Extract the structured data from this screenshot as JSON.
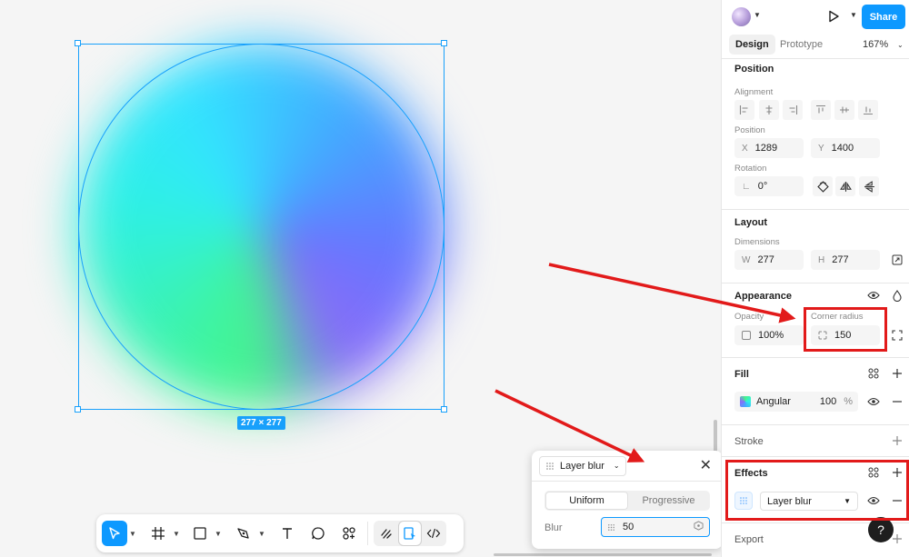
{
  "canvas": {
    "selection_size": "277 × 277"
  },
  "header": {
    "share_label": "Share",
    "tab_design": "Design",
    "tab_prototype": "Prototype",
    "zoom": "167%"
  },
  "position": {
    "title": "Position",
    "alignment_label": "Alignment",
    "position_label": "Position",
    "x_prefix": "X",
    "x_value": "1289",
    "y_prefix": "Y",
    "y_value": "1400",
    "rotation_label": "Rotation",
    "rotation_value": "0°"
  },
  "layout": {
    "title": "Layout",
    "dimensions_label": "Dimensions",
    "w_prefix": "W",
    "w_value": "277",
    "h_prefix": "H",
    "h_value": "277"
  },
  "appearance": {
    "title": "Appearance",
    "opacity_label": "Opacity",
    "opacity_value": "100%",
    "corner_radius_label": "Corner radius",
    "corner_radius_value": "150"
  },
  "fill": {
    "title": "Fill",
    "type": "Angular",
    "opacity": "100",
    "pct": "%"
  },
  "stroke": {
    "title": "Stroke"
  },
  "effects": {
    "title": "Effects",
    "effect_type": "Layer blur"
  },
  "export": {
    "title": "Export"
  },
  "blur_popover": {
    "type": "Layer blur",
    "option_uniform": "Uniform",
    "option_progressive": "Progressive",
    "blur_label": "Blur",
    "blur_value": "50"
  },
  "help": {
    "label": "?"
  },
  "colors": {
    "accent": "#0d99ff",
    "selection": "#18a0fb",
    "annotation": "#e21a1a"
  }
}
